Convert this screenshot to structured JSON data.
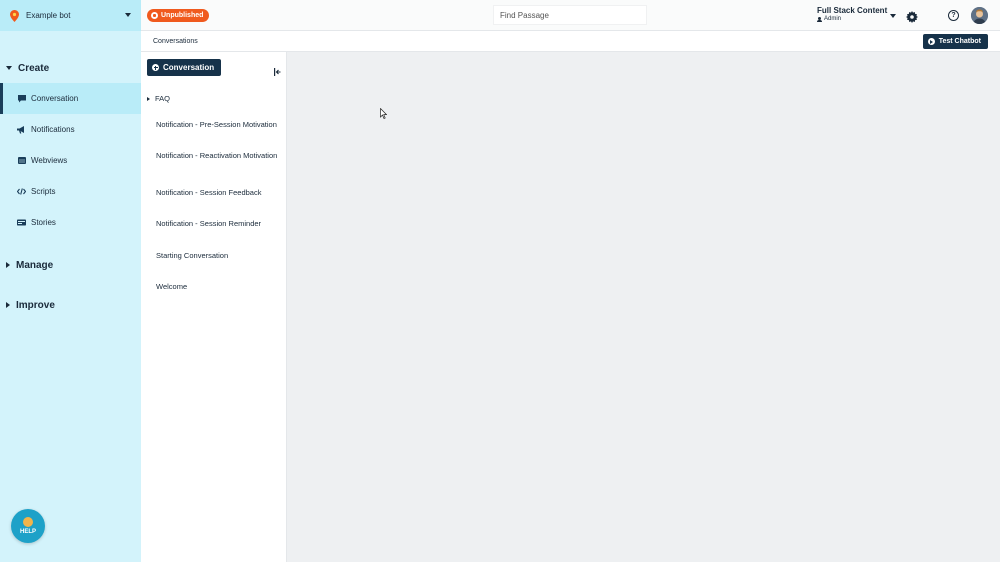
{
  "topbar": {
    "bot_name": "Example bot",
    "status_badge": "Unpublished",
    "search_placeholder": "Find Passage",
    "workspace_name": "Full Stack Content",
    "workspace_role": "Admin",
    "help_symbol": "?"
  },
  "sidebar": {
    "sections": [
      {
        "label": "Create",
        "expanded": true
      },
      {
        "label": "Manage",
        "expanded": false
      },
      {
        "label": "Improve",
        "expanded": false
      }
    ],
    "items": [
      {
        "label": "Conversation",
        "icon": "chat-icon",
        "active": true
      },
      {
        "label": "Notifications",
        "icon": "megaphone-icon",
        "active": false
      },
      {
        "label": "Webviews",
        "icon": "window-icon",
        "active": false
      },
      {
        "label": "Scripts",
        "icon": "code-icon",
        "active": false
      },
      {
        "label": "Stories",
        "icon": "cards-icon",
        "active": false
      }
    ],
    "help_label": "HELP"
  },
  "breadcrumb": {
    "current": "Conversations",
    "test_button": "Test Chatbot"
  },
  "conversations": {
    "new_button": "Conversation",
    "folders": [
      {
        "label": "FAQ"
      }
    ],
    "items": [
      {
        "label": "Notification - Pre-Session Motivation"
      },
      {
        "label": "Notification - Reactivation Motivation"
      },
      {
        "label": "Notification - Session Feedback"
      },
      {
        "label": "Notification - Session Reminder"
      },
      {
        "label": "Starting Conversation"
      },
      {
        "label": "Welcome"
      }
    ]
  },
  "colors": {
    "accent_dark": "#16324a",
    "sidebar_bg": "#d3f3fb",
    "sidebar_active": "#b9ecf8",
    "badge_orange": "#f05a1e",
    "help_blue": "#1da1c8"
  }
}
